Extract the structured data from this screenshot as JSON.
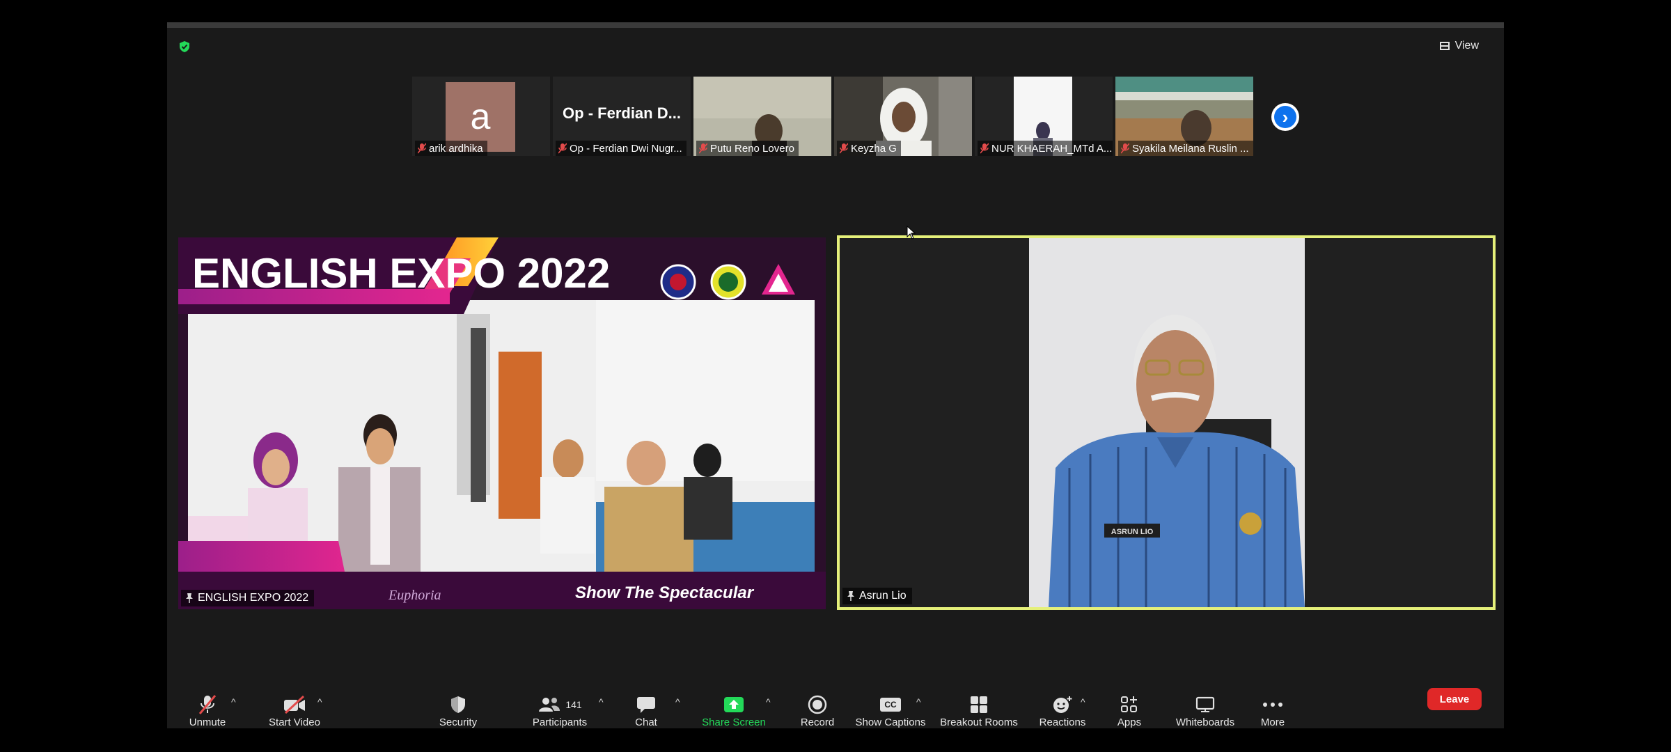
{
  "header": {
    "view_label": "View"
  },
  "thumbnails": [
    {
      "name": "arik ardhika",
      "avatar_letter": "a"
    },
    {
      "name": "Op - Ferdian Dwi Nugr...",
      "display_name": "Op - Ferdian D..."
    },
    {
      "name": "Putu Reno Lovero"
    },
    {
      "name": "Keyzha G"
    },
    {
      "name": "NUR KHAERAH_MTd A..."
    },
    {
      "name": "Syakila Meilana Ruslin ..."
    }
  ],
  "main_tiles": {
    "expo": {
      "name": "ENGLISH EXPO 2022",
      "banner_title": "ENGLISH EXPO 2022",
      "caption_left": "Euphoria",
      "caption_right": "Show The Spectacular"
    },
    "speaker": {
      "name": "Asrun Lio",
      "name_tag": "ASRUN LIO"
    }
  },
  "toolbar": {
    "unmute": "Unmute",
    "start_video": "Start Video",
    "security": "Security",
    "participants": "Participants",
    "participants_count": "141",
    "chat": "Chat",
    "share_screen": "Share Screen",
    "record": "Record",
    "show_captions": "Show Captions",
    "captions_badge": "CC",
    "breakout_rooms": "Breakout Rooms",
    "reactions": "Reactions",
    "apps": "Apps",
    "whiteboards": "Whiteboards",
    "more": "More",
    "leave": "Leave"
  },
  "colors": {
    "active_speaker_border": "#e5f07a",
    "share_green": "#23d959",
    "leave_red": "#e02828",
    "accent_blue": "#0e72ed"
  }
}
